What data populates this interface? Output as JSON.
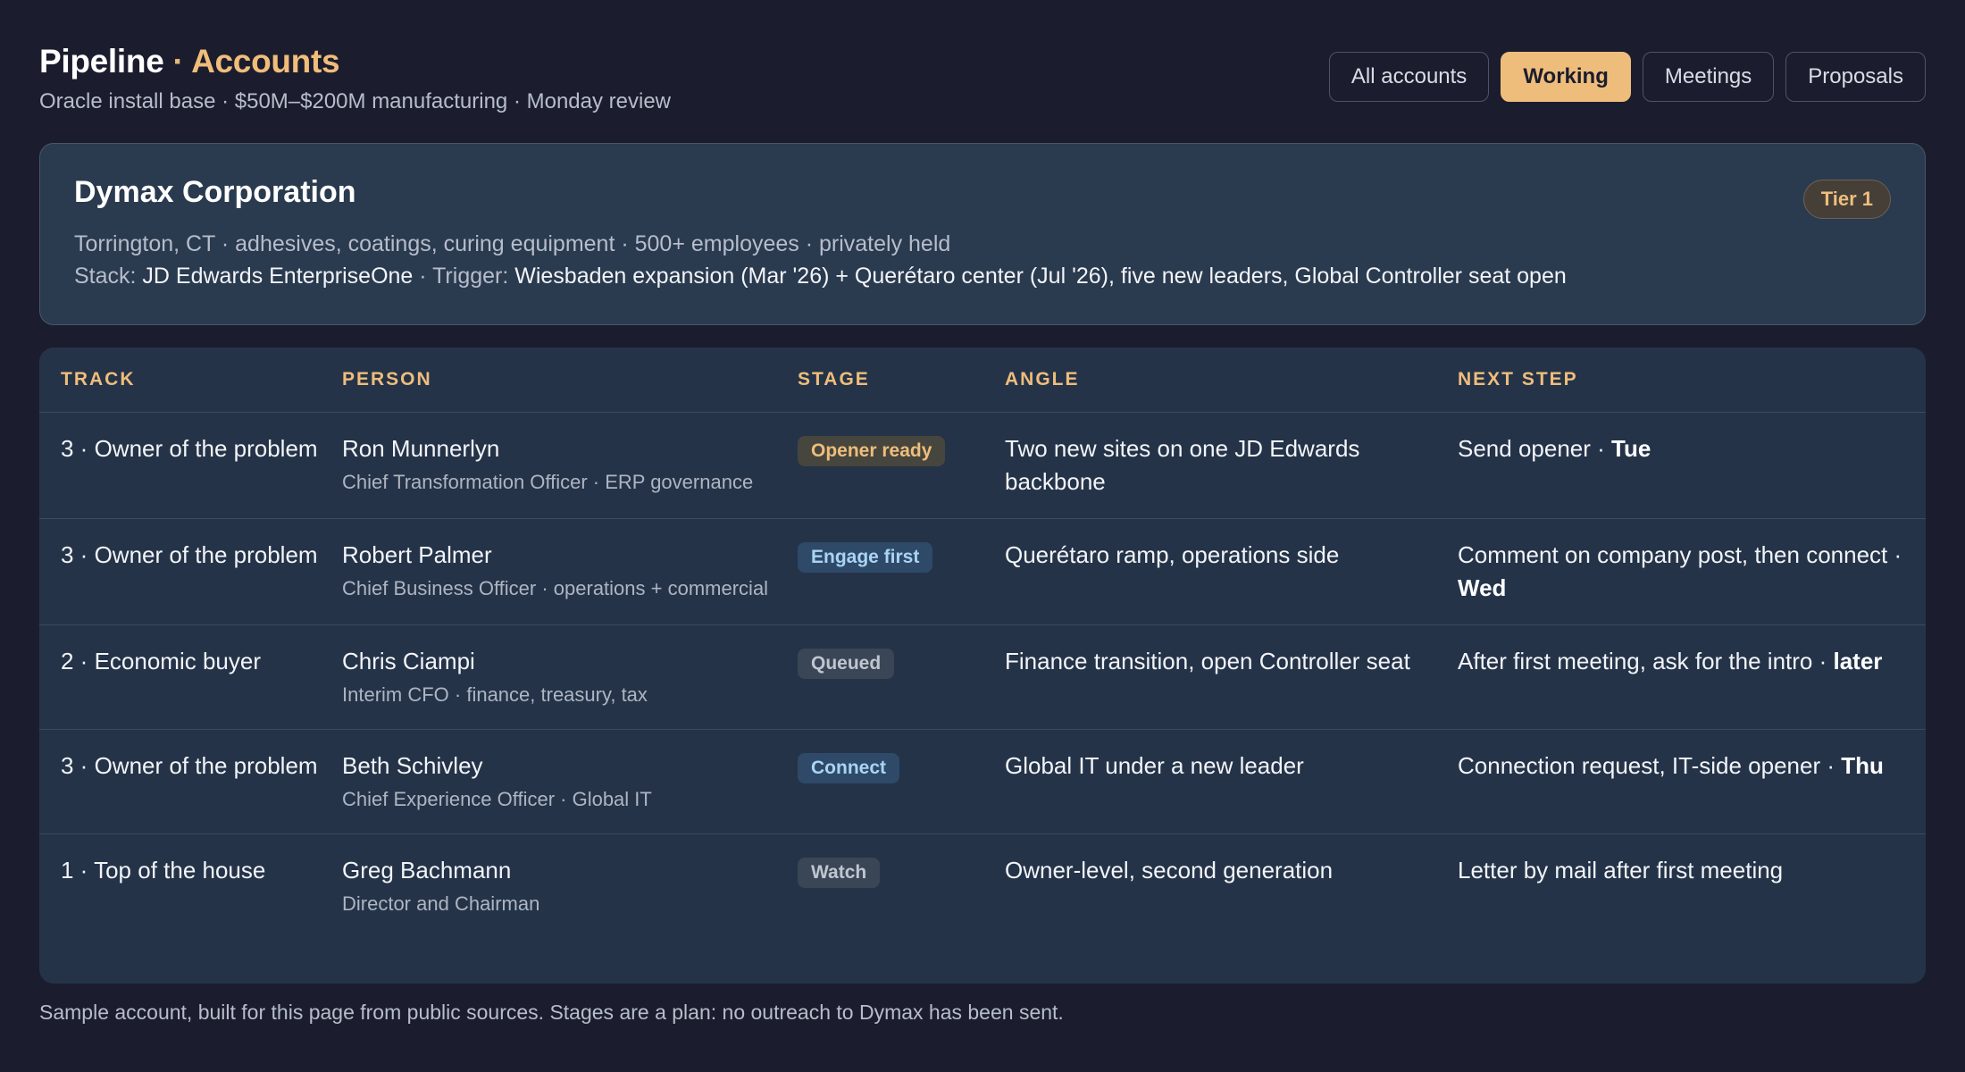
{
  "header": {
    "title_main": "Pipeline",
    "title_sep": " · ",
    "title_section": "Accounts",
    "subtitle": "Oracle install base · $50M–$200M manufacturing · Monday review"
  },
  "tabs": [
    {
      "label": "All accounts",
      "active": false
    },
    {
      "label": "Working",
      "active": true
    },
    {
      "label": "Meetings",
      "active": false
    },
    {
      "label": "Proposals",
      "active": false
    }
  ],
  "account": {
    "name": "Dymax Corporation",
    "tier": "Tier 1",
    "meta": "Torrington, CT · adhesives, coatings, curing equipment · 500+ employees · privately held",
    "stack_label": "Stack: ",
    "stack_value": "JD Edwards EnterpriseOne",
    "trigger_label": " · Trigger: ",
    "trigger_value": "Wiesbaden expansion (Mar '26) + Querétaro center (Jul '26), five new leaders, Global Controller seat open"
  },
  "table": {
    "columns": [
      "TRACK",
      "PERSON",
      "STAGE",
      "ANGLE",
      "NEXT STEP"
    ],
    "rows": [
      {
        "track": "3 · Owner of the problem",
        "person_name": "Ron Munnerlyn",
        "person_role": "Chief Transformation Officer · ERP governance",
        "stage": "Opener ready",
        "angle": "Two new sites on one JD Edwards backbone",
        "next_step": "Send opener · ",
        "next_when": "Tue"
      },
      {
        "track": "3 · Owner of the problem",
        "person_name": "Robert Palmer",
        "person_role": "Chief Business Officer · operations + commercial",
        "stage": "Engage first",
        "angle": "Querétaro ramp, operations side",
        "next_step": "Comment on company post, then connect · ",
        "next_when": "Wed"
      },
      {
        "track": "2 · Economic buyer",
        "person_name": "Chris Ciampi",
        "person_role": "Interim CFO · finance, treasury, tax",
        "stage": "Queued",
        "angle": "Finance transition, open Controller seat",
        "next_step": "After first meeting, ask for the intro · ",
        "next_when": "later"
      },
      {
        "track": "3 · Owner of the problem",
        "person_name": "Beth Schivley",
        "person_role": "Chief Experience Officer · Global IT",
        "stage": "Connect",
        "angle": "Global IT under a new leader",
        "next_step": "Connection request, IT-side opener · ",
        "next_when": "Thu"
      },
      {
        "track": "1 · Top of the house",
        "person_name": "Greg Bachmann",
        "person_role": "Director and Chairman",
        "stage": "Watch",
        "angle": "Owner-level, second generation",
        "next_step": "Letter by mail after first meeting",
        "next_when": ""
      }
    ]
  },
  "footnote": "Sample account, built for this page from public sources. Stages are a plan: no outreach to Dymax has been sent.",
  "colors": {
    "background": "#1b1d2e",
    "accent": "#efbd7b",
    "card": "#2a3a4f",
    "table": "#243348"
  }
}
